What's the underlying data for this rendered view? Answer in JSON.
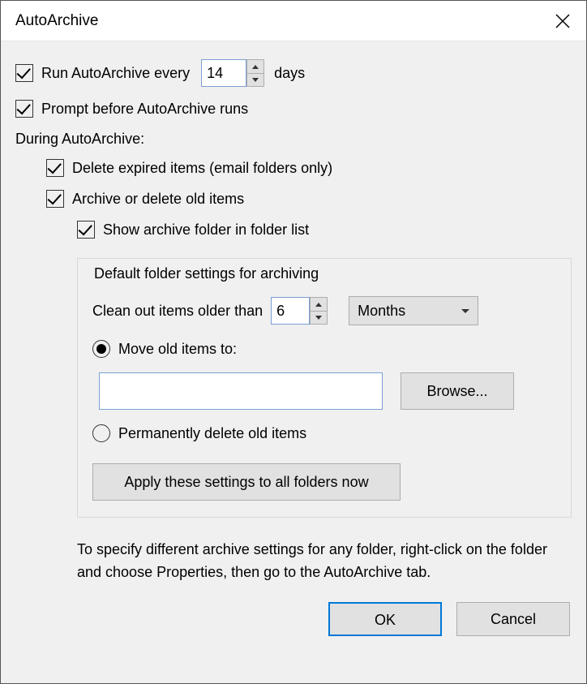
{
  "title": "AutoArchive",
  "run_every": {
    "label": "Run AutoArchive every",
    "value": "14",
    "suffix": "days",
    "checked": true
  },
  "prompt": {
    "label": "Prompt before AutoArchive runs",
    "checked": true
  },
  "during_label": "During AutoArchive:",
  "delete_expired": {
    "label": "Delete expired items (email folders only)",
    "checked": true
  },
  "archive_delete": {
    "label": "Archive or delete old items",
    "checked": true
  },
  "show_folder": {
    "label": "Show archive folder in folder list",
    "checked": true
  },
  "fieldset": {
    "legend": "Default folder settings for archiving",
    "clean_out": {
      "label": "Clean out items older than",
      "value": "6",
      "unit": "Months"
    },
    "move_option": {
      "label": "Move old items to:",
      "selected": true,
      "path": ""
    },
    "browse_label": "Browse...",
    "delete_option": {
      "label": "Permanently delete old items",
      "selected": false
    },
    "apply_label": "Apply these settings to all folders now"
  },
  "help_text": "To specify different archive settings for any folder, right-click on the folder and choose Properties, then go to the AutoArchive tab.",
  "ok_label": "OK",
  "cancel_label": "Cancel"
}
